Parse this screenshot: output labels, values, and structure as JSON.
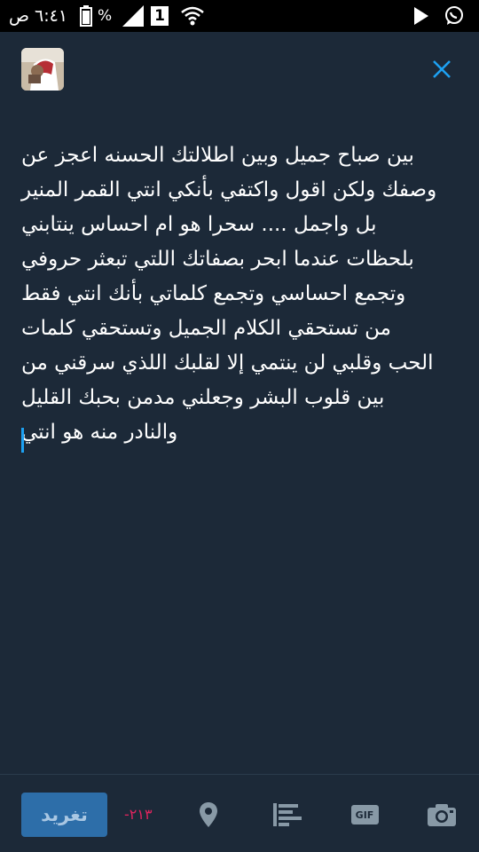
{
  "status_bar": {
    "time": "٦:٤١ ص",
    "battery_percent": "%",
    "sim_label": "1",
    "icons": [
      "battery-icon",
      "signal-icon",
      "wifi-icon",
      "play-store-icon",
      "whatsapp-icon"
    ]
  },
  "compose": {
    "text": "بين صباح جميل وبين اطلالتك الحسنه اعجز عن\nوصفك ولكن اقول واكتفي بأنكي انتي القمر المنير\nبل واجمل .... سحرا هو ام احساس ينتابني\nبلحظات عندما ابحر بصفاتك اللتي تبعثر حروفي\nوتجمع احساسي وتجمع كلماتي بأنك انتي فقط\nمن تستحقي الكلام الجميل وتستحقي كلمات\nالحب وقلبي لن ينتمي إلا لقلبك اللذي سرقني من\nبين قلوب البشر وجعلني مدمن بحبك القليل\nوالنادر منه هو انتي"
  },
  "toolbar": {
    "tweet_label": "تغريد",
    "char_count": "-٢١٣",
    "gif_label": "GIF",
    "icons": [
      "location-icon",
      "poll-icon",
      "gif-icon",
      "camera-icon"
    ]
  },
  "colors": {
    "background": "#1c2938",
    "accent": "#1da1f2",
    "tweet_button": "#2d6ea9",
    "over_limit": "#e0245e",
    "icon_gray": "#8899a6"
  }
}
